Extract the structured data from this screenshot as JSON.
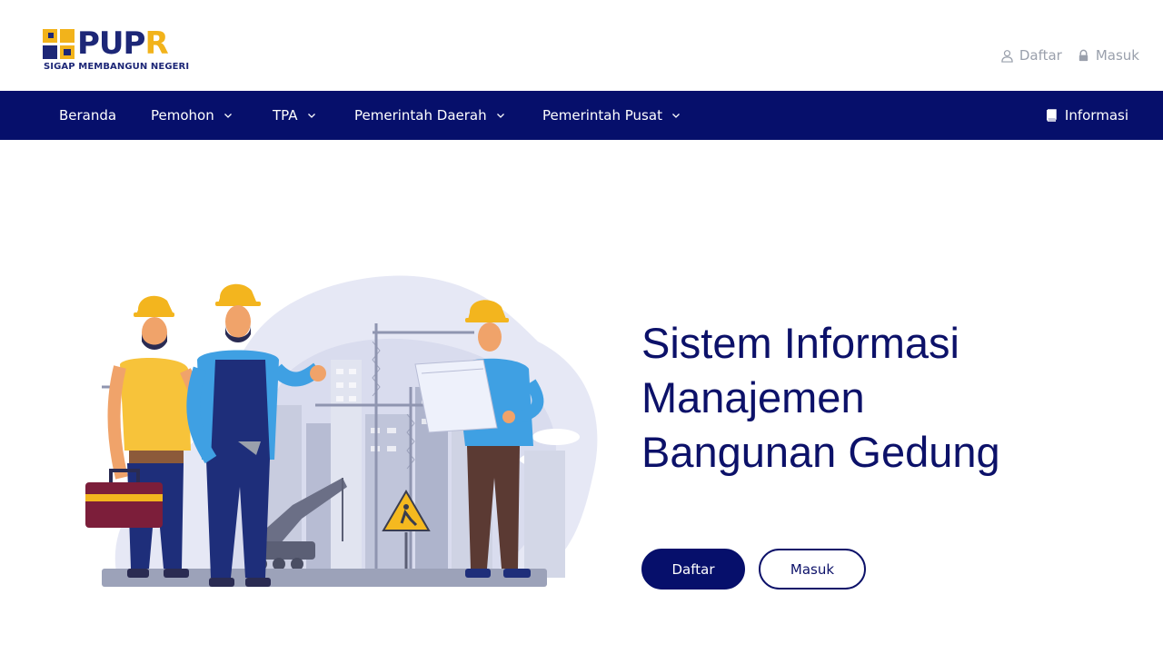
{
  "brand": {
    "name_main": "PUP",
    "name_accent": "R",
    "tagline": "SIGAP MEMBANGUN NEGERI",
    "colors": {
      "navy": "#1d2777",
      "gold": "#f2b31b"
    }
  },
  "auth": {
    "register": {
      "label": "Daftar",
      "icon": "user-icon"
    },
    "login": {
      "label": "Masuk",
      "icon": "lock-icon"
    }
  },
  "nav": {
    "items": [
      {
        "label": "Beranda",
        "has_dropdown": false
      },
      {
        "label": "Pemohon",
        "has_dropdown": true
      },
      {
        "label": "TPA",
        "has_dropdown": true
      },
      {
        "label": "Pemerintah Daerah",
        "has_dropdown": true
      },
      {
        "label": "Pemerintah Pusat",
        "has_dropdown": true
      }
    ],
    "right": {
      "label": "Informasi",
      "icon": "book-icon"
    },
    "background": "#060f6b"
  },
  "hero": {
    "title_lines": [
      "Sistem Informasi",
      "Manajemen",
      "Bangunan Gedung"
    ],
    "primary_button": "Daftar",
    "secondary_button": "Masuk",
    "illustration": "construction-workers-illustration"
  }
}
